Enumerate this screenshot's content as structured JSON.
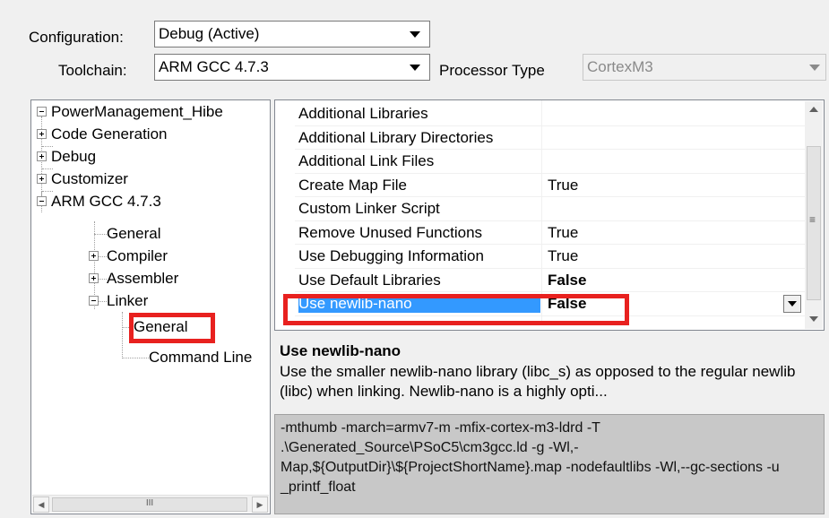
{
  "config": {
    "configuration_label": "Configuration:",
    "configuration_value": "Debug (Active)",
    "toolchain_label": "Toolchain:",
    "toolchain_value": "ARM GCC 4.7.3",
    "processor_label": "Processor Type",
    "processor_value": "CortexM3"
  },
  "tree": {
    "items": [
      {
        "label": "PowerManagement_Hibe",
        "level": 0,
        "expander": "minus"
      },
      {
        "label": "Code Generation",
        "level": 1,
        "expander": "plus"
      },
      {
        "label": "Debug",
        "level": 1,
        "expander": "plus"
      },
      {
        "label": "Customizer",
        "level": 1,
        "expander": "plus"
      },
      {
        "label": "ARM GCC 4.7.3",
        "level": 1,
        "expander": "minus"
      },
      {
        "label": "General",
        "level": 2,
        "expander": "none"
      },
      {
        "label": "Compiler",
        "level": 2,
        "expander": "plus"
      },
      {
        "label": "Assembler",
        "level": 2,
        "expander": "plus"
      },
      {
        "label": "Linker",
        "level": 2,
        "expander": "minus"
      },
      {
        "label": "General",
        "level": 3,
        "expander": "none",
        "selected": true
      },
      {
        "label": "Command Line",
        "level": 3,
        "expander": "none"
      }
    ],
    "hscroll_thumb": "III"
  },
  "properties": {
    "rows": [
      {
        "name": "Additional Libraries",
        "value": ""
      },
      {
        "name": "Additional Library Directories",
        "value": ""
      },
      {
        "name": "Additional Link Files",
        "value": ""
      },
      {
        "name": "Create Map File",
        "value": "True"
      },
      {
        "name": "Custom Linker Script",
        "value": ""
      },
      {
        "name": "Remove Unused Functions",
        "value": "True"
      },
      {
        "name": "Use Debugging Information",
        "value": "True"
      },
      {
        "name": "Use Default Libraries",
        "value": "False",
        "bold": true
      },
      {
        "name": "Use newlib-nano",
        "value": "False",
        "bold": true,
        "selected": true
      }
    ],
    "scroll_grip": "≡"
  },
  "description": {
    "title": "Use newlib-nano",
    "text": "Use the smaller newlib-nano library (libc_s) as opposed to the regular newlib (libc) when linking.  Newlib-nano is a highly opti..."
  },
  "command_line": {
    "text": "-mthumb -march=armv7-m -mfix-cortex-m3-ldrd -T .\\Generated_Source\\PSoC5\\cm3gcc.ld -g -Wl,-Map,${OutputDir}\\${ProjectShortName}.map -nodefaultlibs -Wl,--gc-sections -u _printf_float"
  },
  "colors": {
    "highlight": "#e8211f",
    "selection": "#3399ff",
    "cmd_bg": "#c8c8c8"
  }
}
